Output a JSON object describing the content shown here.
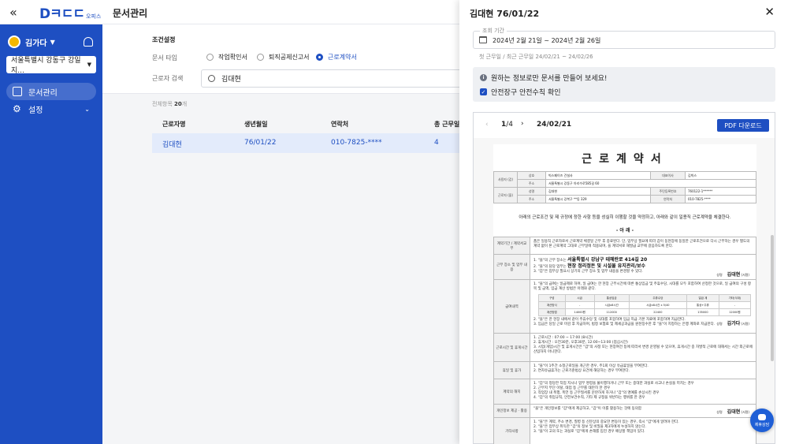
{
  "app": {
    "logo_text": "Dㅋㄷㄷ",
    "logo_sub": "오피스",
    "page_title": "문서관리"
  },
  "sidebar": {
    "user_name": "김가다",
    "branch": "서울특별시 강동구 강일지...",
    "items": [
      {
        "label": "문서관리",
        "active": true
      },
      {
        "label": "설정",
        "active": false
      }
    ]
  },
  "filters": {
    "section_title": "조건설정",
    "doc_type_label": "문서 타입",
    "doc_types": [
      "작업확인서",
      "퇴직공제신고서",
      "근로계약서"
    ],
    "selected_doc_type": "근로계약서",
    "worker_search_label": "근로자 검색",
    "search_value": "김대현"
  },
  "results": {
    "count_prefix": "전체항목",
    "count": "20",
    "count_suffix": "개",
    "columns": [
      "근로자명",
      "생년월일",
      "연락처",
      "총 근무일 수"
    ],
    "rows": [
      {
        "name": "김대현",
        "birth": "76/01/22",
        "phone": "010-7825-****",
        "days": "4"
      }
    ]
  },
  "panel": {
    "title": "김대현 76/01/22",
    "period_legend": "조회 기간",
    "period_value": "2024년 2월 21일 ~ 2024년 2월 26일",
    "first_last": "첫 근무일 / 최근 근무일 24/02/21 ~ 24/02/26",
    "info_text": "원하는 정보로만 문서를 만들어 보세요!",
    "checkbox_label": "안전장구 안전수칙 확인",
    "checkbox_checked": true
  },
  "viewer": {
    "current_page": "1",
    "total_pages": "/4",
    "date": "24/02/21",
    "pdf_button": "PDF 다운로드"
  },
  "contract": {
    "title": "근로계약서",
    "employer_label": "사용자 (갑)",
    "worker_label": "근로자 (을)",
    "company_name_label": "상호",
    "company_name": "빅스페이즈 건설사",
    "ceo_label": "대표이사",
    "ceo": "김빅스",
    "address_label": "주소",
    "company_address": "서울특별시 강동구 아리수로585길 60",
    "worker_name_label": "성명",
    "worker_name": "김대현",
    "rrn_label": "주민등록번호",
    "rrn": "760122-1******",
    "worker_address": "서울특별시 강북구 **동 329",
    "contact_label": "연락처",
    "contact": "010-7825-****",
    "intro": "아래의 근로조건 및 제 규정에 정한 사항 등을 성실히 이행할 것을 약정하고, 아래와 같이 일용직 근로계약을 체결한다.",
    "sub": "- 아 래 -",
    "sec_period_label": "계약기간 / 계약서교부",
    "sec_period_text": "품은 일용직 근로자로서 근로계약 체결일 근무 후 종료된다. 단, 업무상 필요에 따라 갑이 동현장에 동일한 근로조건으로 다시 근무하는 경우 별도의 계약 없이 본 근로계약 그대로 근무일에 적용되며, 을 계약서로 재발급 교부에 갈음하도록 한다.",
    "sec_place_label": "근무 장소 및 업무 내용",
    "place_1": "1. \"을\"의 근무 장소는",
    "place_value": "서울특별시 강남구 테헤란로 414길 20",
    "place_2": "2. \"을\"의 담당 업무는",
    "work_value": "현장 정리정돈 및 시설물 유지관리/보수",
    "place_3": "3. \"갑\"은 업무상 필요시 상기의 근무 장소 및 업무 내용을 변경할 수 있다.",
    "place_suffix": "(으)로 한다.",
    "sign_label": "성명",
    "sign_worker": "김대현",
    "sign_employer": "김가다",
    "seal": "(서명)",
    "sec_wage_label": "급여내역",
    "wage_text": "1. \"을\"의 급여는 일급제로 하며, 일 급여는 한 현장 근무시간에 따른 통상임금 및 주휴수당, 시대를 모두 포함하여 산정한 것으로, 일 급여의 구성 항목 및 금액, 임금 계산 방법은 아래와 같다.",
    "pay_headers": [
      "구성",
      "시급",
      "통상임금",
      "주휴수당",
      "일급 계",
      "기타(식대)"
    ],
    "pay_row1": [
      "계산방식",
      "-",
      "시급x8시간",
      "시급x8시간 x 5/40",
      "통상+주휴",
      "-"
    ],
    "pay_row2": [
      "계산방법",
      "14000원",
      "112000",
      "22400",
      "135000",
      "12000원"
    ],
    "wage_text2": "2. \"을\"은 한 현장 내에서 같이 주휴수당 및 식대를 포함하여 임금 지급 기본 자료에 포함하여 지급한다.",
    "wage_text3": "3. 임금은 당일 근로 마감 후 지급하며, 법정 보험료 및 제세공과금을 원천징수한 후 \"을\"이 지정하는 은행 계좌로 지급한다.",
    "sec_hours_label": "근로시간 및 휴게시간",
    "hours_text": "1. 근로시간 : 07:00 ~ 17:00 (8시간)\n2. 휴게시간 : 오전30분, 오후30분, 12:00~13:00 (점심시간)\n3. 시업(개업)시간 및 휴게시간은 \"갑\"의 사정 또는 현장여건 등에 따라서 변경 운영될 수 있으며, 휴게시간 중 자발적 근로에 대해서는 시간 외근로에 산입하지 아니한다.",
    "sec_leave_label": "휴일 및 휴가",
    "leave_text": "1. \"을\"이 1주간 소정근로일을 개근한 경우, 주1회 이상 유급휴일을 부여한다.\n2. 연차유급휴가는 근로기준법상 요건에 해당하는 경우 부여한다.",
    "sec_term_label": "계약의 해지",
    "term_text": "1. \"갑\"의 정당한 작업 지시나 업무 명령을 불이행하거나 근무 또는 중대한 과실로 사고나 손실을 끼치는 경우\n2. 근무지 무단 이탈, 태업 등 근무를 태만히 한 경우\n3. 작업장 내 폭행, 폭언 등 근무질서를 문란하게 하거나 \"갑\"의 명예를 손상시킨 경우\n4. \"갑\"의 취업규칙, 안전보건수칙, 기타 제 규정을 위반하는 행위를 한 경우",
    "sec_privacy_label": "개인정보 제공 · 활용",
    "privacy_text": "\"을\"은 개인정보를 \"갑\"에게 제공하고, \"갑\"이 이를 활용하는 것에 동의함",
    "sec_other_label": "기타사항",
    "other_text": "1. \"을\"은 계약, 주소 변경, 질병 등 신분상의 중요한 변동이 있는 경우, 즉시 \"갑\"에게 알려야 한다.\n2. \"을\"은 업무상 취득한 \"갑\"의 정보 및 비밀을 제3자에게 누설하지 않는다.\n3. \"을\"이 고의 또는 과실로 \"갑\"에게 손해를 입힌 경우 배상할 책임이 있다."
  },
  "fab": {
    "label": "제휴상담"
  }
}
